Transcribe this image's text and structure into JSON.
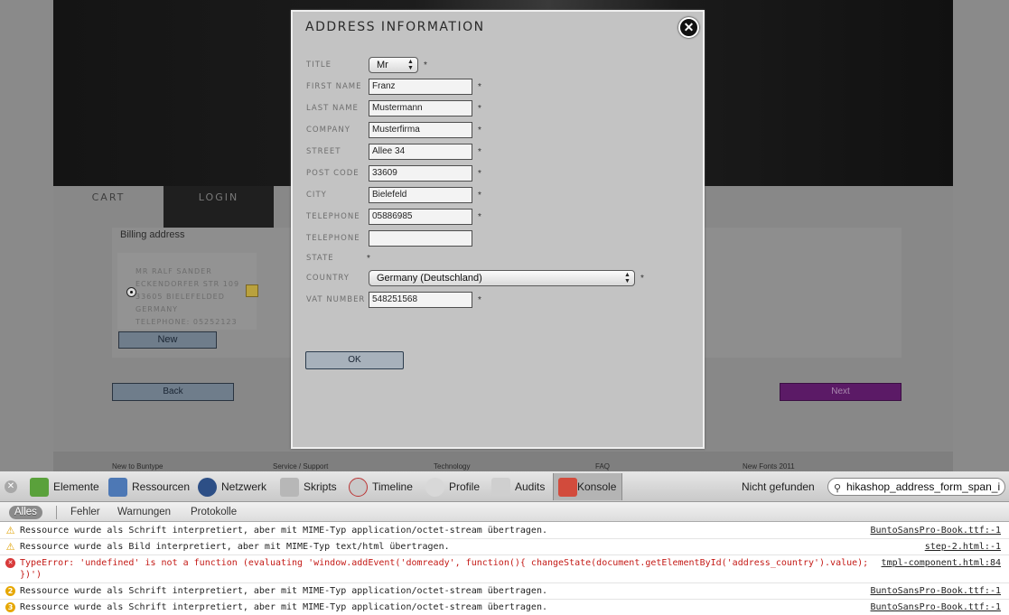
{
  "background_page": {
    "steps": {
      "cart": "CART",
      "login": "LOGIN"
    },
    "billing": {
      "title": "Billing address",
      "address_lines": [
        "MR RALF SANDER",
        "ECKENDORFER STR 109",
        "33605 BIELEFELDED",
        "GERMANY",
        "TELEPHONE: 05252123"
      ],
      "new_label": "New"
    },
    "back_label": "Back",
    "next_label": "Next",
    "footer_links": [
      "New to Buntype",
      "Service / Support",
      "Technology",
      "FAQ",
      "New Fonts 2011"
    ]
  },
  "modal": {
    "title": "ADDRESS INFORMATION",
    "close_label": "✕",
    "fields": {
      "title": {
        "label": "TITLE",
        "value": "Mr"
      },
      "first_name": {
        "label": "FIRST NAME",
        "value": "Franz"
      },
      "last_name": {
        "label": "LAST NAME",
        "value": "Mustermann"
      },
      "company": {
        "label": "COMPANY",
        "value": "Musterfirma"
      },
      "street": {
        "label": "STREET",
        "value": "Allee 34"
      },
      "post_code": {
        "label": "POST CODE",
        "value": "33609"
      },
      "city": {
        "label": "CITY",
        "value": "Bielefeld"
      },
      "telephone": {
        "label": "TELEPHONE",
        "value": "05886985"
      },
      "telephone2": {
        "label": "TELEPHONE",
        "value": ""
      },
      "state": {
        "label": "STATE"
      },
      "country": {
        "label": "COUNTRY",
        "value": "Germany (Deutschland)"
      },
      "vat_number": {
        "label": "VAT NUMBER",
        "value": "548251568"
      }
    },
    "required_mark": "*",
    "ok_label": "OK"
  },
  "devtools": {
    "tabs": [
      "Elemente",
      "Ressourcen",
      "Netzwerk",
      "Skripts",
      "Timeline",
      "Profile",
      "Audits",
      "Konsole"
    ],
    "active_tab": "Konsole",
    "not_found": "Nicht gefunden",
    "search_value": "hikashop_address_form_span_i",
    "filters": [
      "Alles",
      "Fehler",
      "Warnungen",
      "Protokolle"
    ],
    "active_filter": "Alles",
    "log": [
      {
        "type": "warning",
        "badge": "⚠",
        "message": "Ressource wurde als Schrift interpretiert, aber mit MIME-Typ application/octet-stream übertragen.",
        "source": "BuntoSansPro-Book.ttf:-1"
      },
      {
        "type": "warning",
        "badge": "⚠",
        "message": "Ressource wurde als Bild interpretiert, aber mit MIME-Typ text/html übertragen.",
        "source": "step-2.html:-1"
      },
      {
        "type": "error",
        "badge": "✕",
        "message": "TypeError: 'undefined' is not a function (evaluating 'window.addEvent('domready', function(){ changeState(document.getElementById('address_country').value); })')",
        "source": "tmpl-component.html:84"
      },
      {
        "type": "count",
        "badge": "2",
        "message": "Ressource wurde als Schrift interpretiert, aber mit MIME-Typ application/octet-stream übertragen.",
        "source": "BuntoSansPro-Book.ttf:-1"
      },
      {
        "type": "count",
        "badge": "3",
        "message": "Ressource wurde als Schrift interpretiert, aber mit MIME-Typ application/octet-stream übertragen.",
        "source": "BuntoSansPro-Book.ttf:-1"
      }
    ]
  },
  "colors": {
    "next_button": "#5b1a66",
    "error_text": "#c41a16",
    "warning_icon": "#e0a100"
  }
}
